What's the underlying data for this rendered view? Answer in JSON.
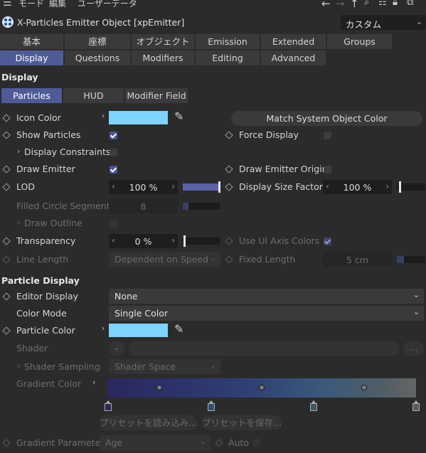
{
  "menubar": {
    "mode": "モード",
    "edit": "編集",
    "userdata": "ユーザーデータ"
  },
  "window": {
    "title": "X-Particles Emitter Object [xpEmitter]",
    "preset": "カスタム"
  },
  "tabs_row1": [
    "基本",
    "座標",
    "オブジェクト",
    "Emission",
    "Extended Data",
    "Groups"
  ],
  "tabs_row2": [
    "Display",
    "Questions",
    "Modifiers",
    "Editing",
    "Advanced"
  ],
  "display": {
    "section": "Display",
    "subtabs": [
      "Particles",
      "HUD",
      "Modifier Field"
    ],
    "icon_color": "Icon Color",
    "match_btn": "Match System Object Color",
    "show_particles": "Show Particles",
    "force_display": "Force Display",
    "display_constraints": "Display Constraints",
    "draw_emitter": "Draw Emitter",
    "draw_emitter_origin": "Draw Emitter Origin",
    "lod": "LOD",
    "lod_value": "100 %",
    "lod_level": 1.0,
    "display_size_factor": "Display Size Factor",
    "dsf_value": "100 %",
    "filled_circle_segments": "Filled Circle Segments",
    "fcs_value": "8",
    "draw_outline": "Draw Outline",
    "transparency": "Transparency",
    "transparency_value": "0 %",
    "use_ui_axis_colors": "Use UI Axis Colors",
    "line_length": "Line Length",
    "line_length_value": "Dependent on Speed",
    "fixed_length": "Fixed Length",
    "fixed_length_value": "5 cm"
  },
  "particle_display": {
    "section": "Particle Display",
    "editor_display": "Editor Display",
    "editor_display_value": "None",
    "color_mode": "Color Mode",
    "color_mode_value": "Single Color",
    "particle_color": "Particle Color",
    "shader": "Shader",
    "shader_more": "...",
    "shader_sampling": "Shader Sampling",
    "shader_sampling_value": "Shader Space",
    "gradient_color": "Gradient Color",
    "load_preset": "プリセットを読み込み...",
    "save_preset": "プリセットを保存...",
    "gradient_parameter": "Gradient Parameter",
    "gradient_parameter_value": "Age",
    "auto": "Auto"
  },
  "colors": {
    "accent": "#4e5b96",
    "swatch": "#7fd3ff"
  }
}
